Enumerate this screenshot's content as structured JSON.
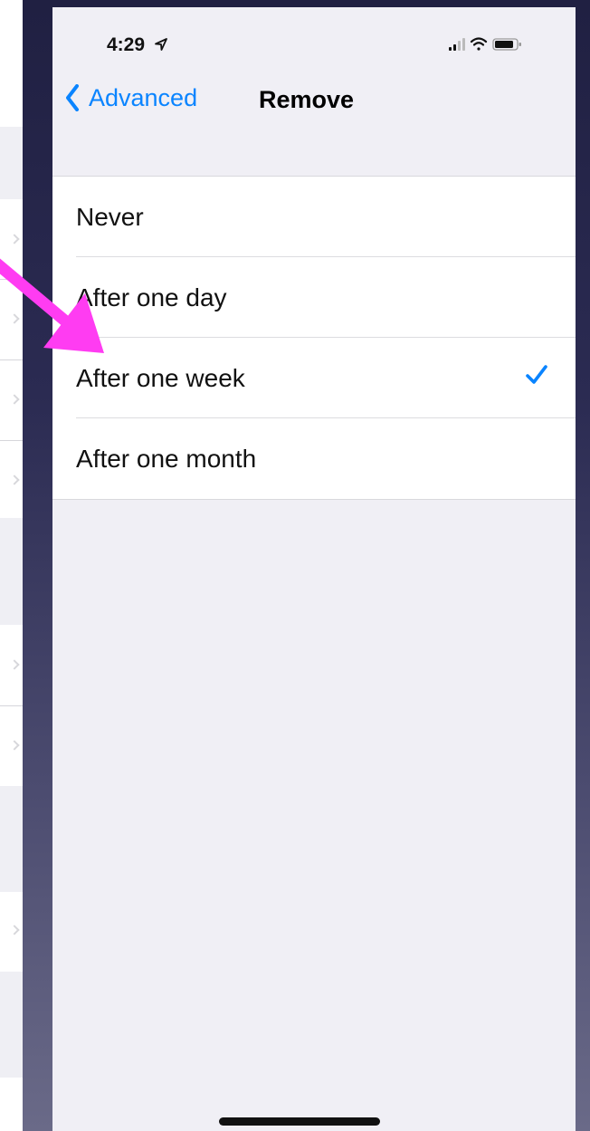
{
  "status_bar": {
    "time": "4:29"
  },
  "nav": {
    "back_label": "Advanced",
    "title": "Remove"
  },
  "options": [
    {
      "label": "Never",
      "selected": false
    },
    {
      "label": "After one day",
      "selected": false
    },
    {
      "label": "After one week",
      "selected": true
    },
    {
      "label": "After one month",
      "selected": false
    }
  ],
  "icons": {
    "back": "chevron-left-icon",
    "check": "checkmark-icon",
    "signal": "signal-icon",
    "wifi": "wifi-icon",
    "battery": "battery-icon",
    "location": "location-arrow-icon",
    "annotation": "pointer-arrow"
  },
  "colors": {
    "accent": "#0a84ff",
    "annotation_arrow": "#ff3cf2",
    "screen_background": "#f0eff5"
  }
}
